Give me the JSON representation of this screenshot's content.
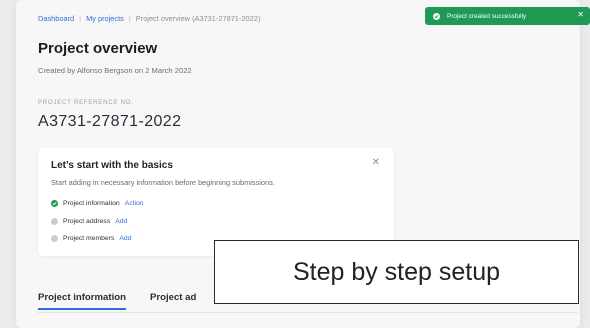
{
  "breadcrumb": {
    "items": [
      "Dashboard",
      "My projects",
      "Project overview (A3731-27871-2022)"
    ]
  },
  "header": {
    "title": "Project overview",
    "subtitle": "Created by Alfonso Bergson on 2 March 2022"
  },
  "reference": {
    "label": "PROJECT REFERENCE NO.",
    "value": "A3731-27871-2022"
  },
  "setup_card": {
    "title": "Let’s start with the basics",
    "description": "Start adding in necessary information before beginning submissions.",
    "close_icon": "✕",
    "steps": [
      {
        "label": "Project information",
        "link": "Action",
        "status": "done"
      },
      {
        "label": "Project address",
        "link": "Add",
        "status": "pending"
      },
      {
        "label": "Project members",
        "link": "Add",
        "status": "pending"
      }
    ]
  },
  "tabs": [
    {
      "label": "Project information",
      "active": true
    },
    {
      "label": "Project ad"
    }
  ],
  "toast": {
    "message": "Project created successfully",
    "close_icon": "✕",
    "color": "#1f9a55"
  },
  "callout": {
    "text": "Step by step setup"
  },
  "colors": {
    "accent": "#2f6fe0",
    "success": "#1f9a55"
  },
  "icons": {
    "check": "check-icon",
    "pending": "pending-dot-icon",
    "close": "close-icon"
  }
}
